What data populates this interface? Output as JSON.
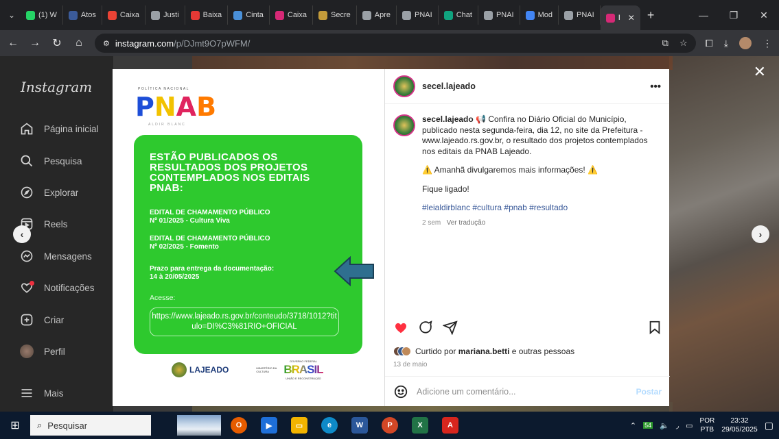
{
  "browser": {
    "tabs": [
      {
        "label": "(1) W",
        "color": "#25d366"
      },
      {
        "label": "Atos",
        "color": "#3b5b9a"
      },
      {
        "label": "Caixa",
        "color": "#ea4335"
      },
      {
        "label": "Justi",
        "color": "#9aa0a6"
      },
      {
        "label": "Baixa",
        "color": "#e53935"
      },
      {
        "label": "Cinta",
        "color": "#4a90d9"
      },
      {
        "label": "Caixa",
        "color": "#d62976"
      },
      {
        "label": "Secre",
        "color": "#c39b3a"
      },
      {
        "label": "Apre",
        "color": "#9aa0a6"
      },
      {
        "label": "PNAI",
        "color": "#9aa0a6"
      },
      {
        "label": "Chat",
        "color": "#10a37f"
      },
      {
        "label": "PNAI",
        "color": "#9aa0a6"
      },
      {
        "label": "Mod",
        "color": "#4285f4"
      },
      {
        "label": "PNAI",
        "color": "#9aa0a6"
      },
      {
        "label": "I",
        "color": "#d62976"
      }
    ],
    "url_host": "instagram.com",
    "url_path": "/p/DJmt9O7pWFM/"
  },
  "sidebar": {
    "logo": "Instagram",
    "items": [
      {
        "label": "Página inicial",
        "icon": "home-icon"
      },
      {
        "label": "Pesquisa",
        "icon": "search-icon"
      },
      {
        "label": "Explorar",
        "icon": "compass-icon"
      },
      {
        "label": "Reels",
        "icon": "reels-icon"
      },
      {
        "label": "Mensagens",
        "icon": "messenger-icon"
      },
      {
        "label": "Notificações",
        "icon": "heart-icon"
      },
      {
        "label": "Criar",
        "icon": "plus-square-icon"
      },
      {
        "label": "Perfil",
        "icon": "avatar"
      },
      {
        "label": "Mais",
        "icon": "menu-icon"
      }
    ]
  },
  "post": {
    "image": {
      "top_label": "POLÍTICA NACIONAL",
      "logo_letters": [
        "P",
        "N",
        "A",
        "B"
      ],
      "logo_colors": [
        "#1d4ed8",
        "#f2c200",
        "#e0245e",
        "#ff7a00"
      ],
      "sub_label": "ALDIR BLANC",
      "title": "ESTÃO PUBLICADOS OS RESULTADOS DOS PROJETOS CONTEMPLADOS NOS EDITAIS PNAB:",
      "edital1": "EDITAL DE CHAMAMENTO PÚBLICO\nNº 01/2025  - Cultura Viva",
      "edital2": "EDITAL DE CHAMAMENTO PÚBLICO\nNº 02/2025 - Fomento",
      "prazo": "Prazo para entrega da documentação:\n14 à 20/05/2025",
      "acesse": "Acesse:",
      "link": "https://www.lajeado.rs.gov.br/conteudo/3718/1012?titulo=DI%C3%81RIO+OFICIAL",
      "lajeado": "LAJEADO",
      "ministerio": "MINISTÉRIO DA CULTURA",
      "governo": "GOVERNO FEDERAL",
      "brasil": "BRASIL",
      "uniao": "UNIÃO E RECONSTRUÇÃO"
    },
    "username": "secel.lajeado",
    "caption_line1": "📢 Confira no Diário Oficial do Município, publicado nesta segunda-feira, dia 12, no site da Prefeitura - www.lajeado.rs.gov.br, o resultado dos projetos contemplados nos editais da PNAB Lajeado.",
    "caption_line2": "⚠️ Amanhã divulgaremos mais informações! ⚠️",
    "caption_line3": "Fique ligado!",
    "hashtags": "#leialdirblanc #cultura #pnab #resultado",
    "time_ago": "2 sem",
    "translate": "Ver tradução",
    "liked_by_prefix": "Curtido por",
    "liked_by_user": "mariana.betti",
    "liked_by_suffix": "e outras pessoas",
    "date": "13 de maio",
    "comment_placeholder": "Adicione um comentário...",
    "post_label": "Postar"
  },
  "taskbar": {
    "search": "Pesquisar",
    "lang1": "POR",
    "lang2": "PTB",
    "time": "23:32",
    "date": "29/05/2025"
  }
}
